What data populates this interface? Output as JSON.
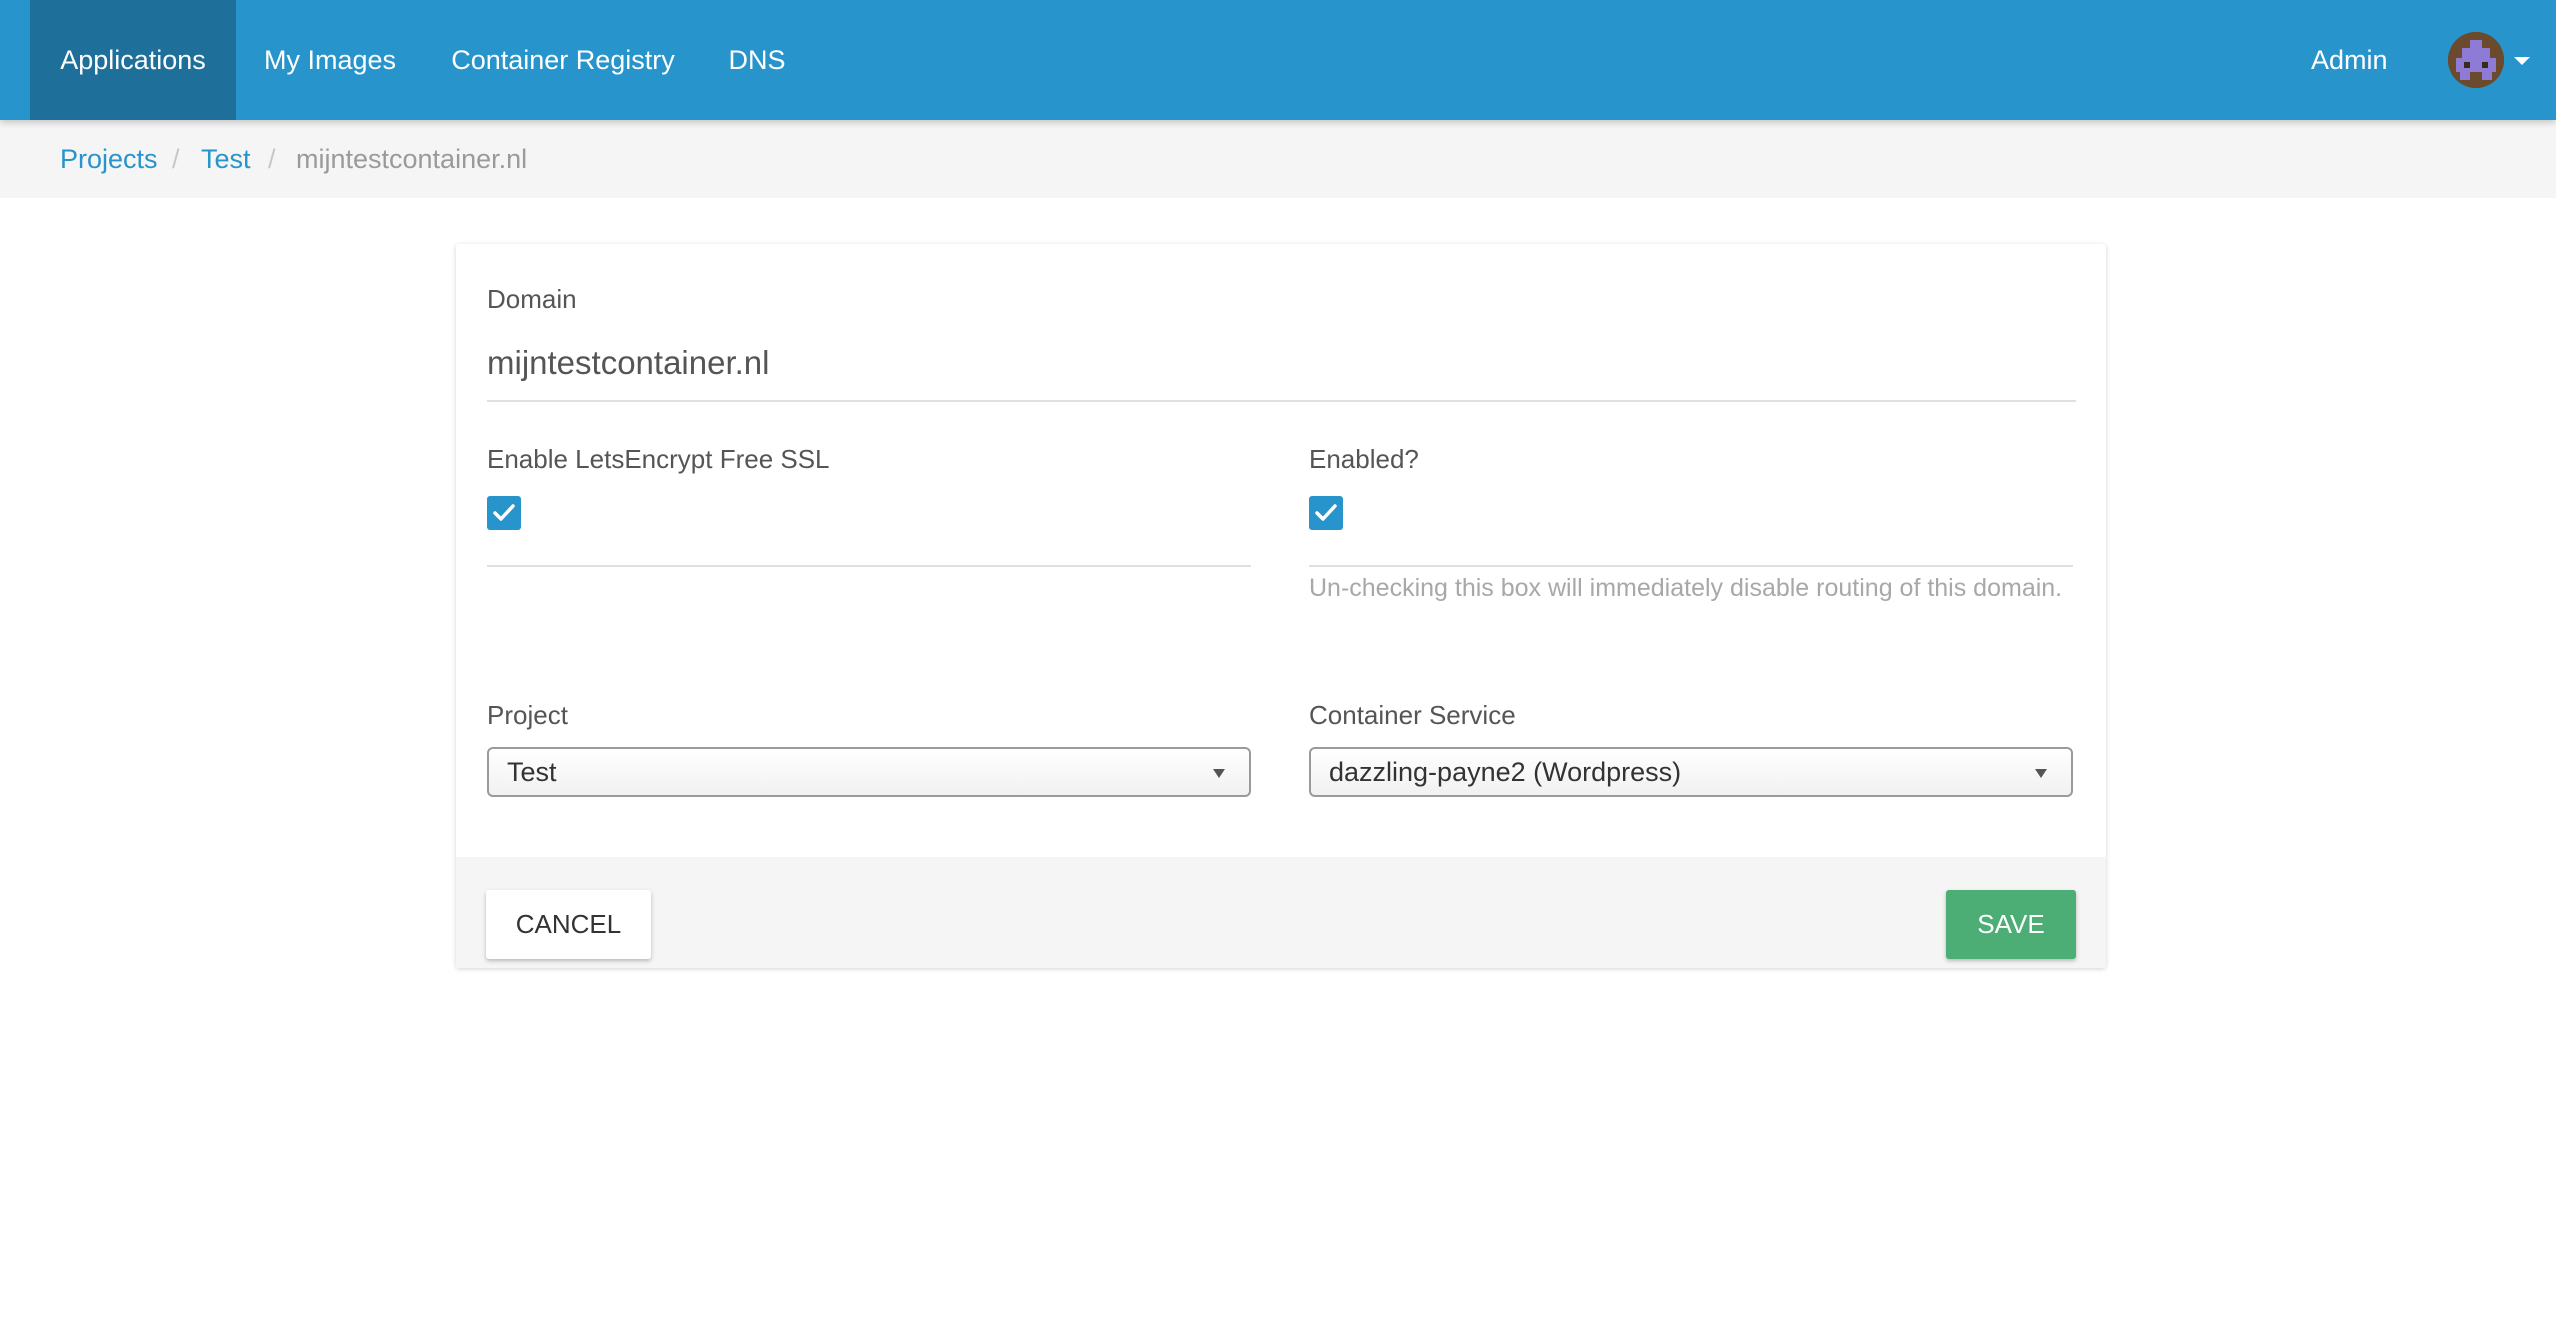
{
  "nav": {
    "items": [
      {
        "label": "Applications",
        "active": true
      },
      {
        "label": "My Images",
        "active": false
      },
      {
        "label": "Container Registry",
        "active": false
      },
      {
        "label": "DNS",
        "active": false
      }
    ],
    "admin_label": "Admin",
    "avatar_icon": "user-avatar-icon",
    "menu_icon": "caret-down-icon",
    "brand_color": "#2794cc",
    "active_color": "#1f6f9b"
  },
  "breadcrumb": {
    "items": [
      "Projects",
      "Test",
      "mijntestcontainer.nl"
    ],
    "separator": "/"
  },
  "form": {
    "domain_label": "Domain",
    "domain_value": "mijntestcontainer.nl",
    "ssl_label": "Enable LetsEncrypt Free SSL",
    "ssl_checked": true,
    "enabled_label": "Enabled?",
    "enabled_checked": true,
    "enabled_help": "Un-checking this box will immediately disable routing of this domain.",
    "project_label": "Project",
    "project_value": "Test",
    "service_label": "Container Service",
    "service_value": "dazzling-payne2 (Wordpress)"
  },
  "actions": {
    "cancel_label": "CANCEL",
    "save_label": "SAVE",
    "save_color": "#4cae75"
  }
}
